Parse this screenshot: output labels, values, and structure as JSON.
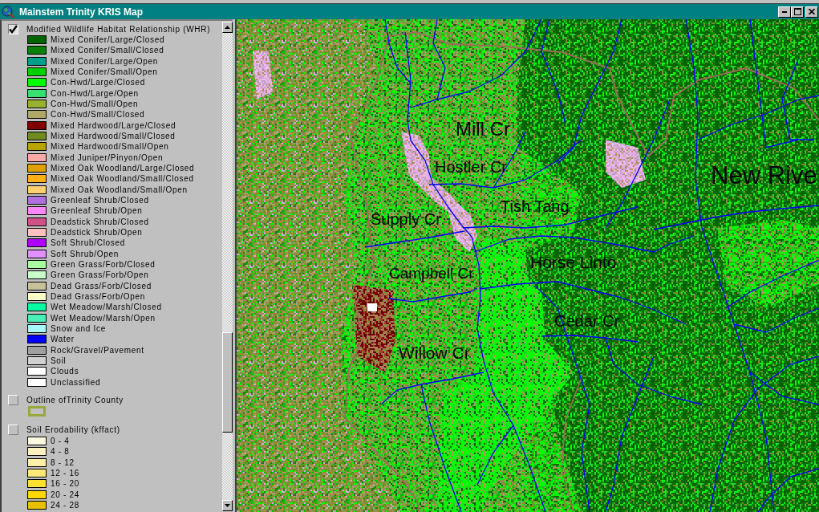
{
  "window": {
    "title": "Mainstem Trinity KRIS Map"
  },
  "legend": {
    "layers": [
      {
        "name": "Modified Wildlife Habitat Relationship (WHR)",
        "checked": true,
        "classes": [
          {
            "kind": "fill",
            "label": "Mixed Conifer/Large/Closed",
            "color": "#006400"
          },
          {
            "kind": "fill",
            "label": "Mixed Conifer/Small/Closed",
            "color": "#0a800a"
          },
          {
            "kind": "fill",
            "label": "Mixed Conifer/Large/Open",
            "color": "#00a08c"
          },
          {
            "kind": "fill",
            "label": "Mixed Conifer/Small/Open",
            "color": "#00d000"
          },
          {
            "kind": "fill",
            "label": "Con-Hwd/Large/Closed",
            "color": "#00ff00"
          },
          {
            "kind": "fill",
            "label": "Con-Hwd/Large/Open",
            "color": "#38e070"
          },
          {
            "kind": "fill",
            "label": "Con-Hwd/Small/Open",
            "color": "#99b131"
          },
          {
            "kind": "fill",
            "label": "Con-Hwd/Small/Closed",
            "color": "#b0a868"
          },
          {
            "kind": "fill",
            "label": "Mixed Hardwood/Large/Closed",
            "color": "#800000"
          },
          {
            "kind": "fill",
            "label": "Mixed Hardwood/Small/Closed",
            "color": "#6f8a20"
          },
          {
            "kind": "fill",
            "label": "Mixed Hardwood/Small/Open",
            "color": "#b8a400"
          },
          {
            "kind": "fill",
            "label": "Mixed Juniper/Pinyon/Open",
            "color": "#ffa8a8"
          },
          {
            "kind": "fill",
            "label": "Mixed Oak Woodland/Large/Closed",
            "color": "#e0a000"
          },
          {
            "kind": "fill",
            "label": "Mixed Oak Woodland/Small/Closed",
            "color": "#ffb018"
          },
          {
            "kind": "fill",
            "label": "Mixed Oak Woodland/Small/Open",
            "color": "#ffd070"
          },
          {
            "kind": "fill",
            "label": "Greenleaf Shrub/Closed",
            "color": "#b070e0"
          },
          {
            "kind": "fill",
            "label": "Greenleaf Shrub/Open",
            "color": "#ff88f8"
          },
          {
            "kind": "fill",
            "label": "Deadstick Shrub/Closed",
            "color": "#d05088"
          },
          {
            "kind": "fill",
            "label": "Deadstick Shrub/Open",
            "color": "#ffc0c0"
          },
          {
            "kind": "fill",
            "label": "Soft Shrub/Closed",
            "color": "#b000ff"
          },
          {
            "kind": "fill",
            "label": "Soft Shrub/Open",
            "color": "#e090ff"
          },
          {
            "kind": "fill",
            "label": "Green Grass/Forb/Closed",
            "color": "#a8ffa0"
          },
          {
            "kind": "fill",
            "label": "Green Grass/Forb/Open",
            "color": "#c8ffc8"
          },
          {
            "kind": "fill",
            "label": "Dead Grass/Forb/Closed",
            "color": "#c8c098"
          },
          {
            "kind": "fill",
            "label": "Dead Grass/Forb/Open",
            "color": "#ffffc8"
          },
          {
            "kind": "fill",
            "label": "Wet Meadow/Marsh/Closed",
            "color": "#00ffa0"
          },
          {
            "kind": "fill",
            "label": "Wet Meadow/Marsh/Open",
            "color": "#48f0b8"
          },
          {
            "kind": "fill",
            "label": "Snow and Ice",
            "color": "#a8f8ff"
          },
          {
            "kind": "fill",
            "label": "Water",
            "color": "#0000ff"
          },
          {
            "kind": "fill",
            "label": "Rock/Gravel/Pavement",
            "color": "#a0a0a0"
          },
          {
            "kind": "fill",
            "label": "Soil",
            "color": "#d0d0d0"
          },
          {
            "kind": "fill",
            "label": "Clouds",
            "color": "#ffffff"
          },
          {
            "kind": "fill",
            "label": "Unclassified",
            "color": "#ffffff"
          }
        ]
      },
      {
        "name": "Outline ofTrinity County",
        "checked": false,
        "classes": [
          {
            "kind": "outline",
            "color": "#9aa83a"
          }
        ]
      },
      {
        "name": "Soil Erodability (kffact)",
        "checked": false,
        "classes": [
          {
            "kind": "fill",
            "label": "0 - 4",
            "color": "#fff8e0"
          },
          {
            "kind": "fill",
            "label": "4 - 8",
            "color": "#fff0c0"
          },
          {
            "kind": "fill",
            "label": "8 - 12",
            "color": "#fff0a8"
          },
          {
            "kind": "fill",
            "label": "12 - 16",
            "color": "#ffe878"
          },
          {
            "kind": "fill",
            "label": "16 - 20",
            "color": "#ffe030"
          },
          {
            "kind": "fill",
            "label": "20 - 24",
            "color": "#ffd800"
          },
          {
            "kind": "fill",
            "label": "24 - 28",
            "color": "#e8c000"
          }
        ]
      }
    ]
  },
  "map": {
    "labels": [
      "Mill Cr",
      "Hostler Cr",
      "New Rive",
      "Tish Tang",
      "Supply Cr",
      "Horse Linto",
      "Campbell Cr",
      "Cedar Cr",
      "Willow Cr"
    ]
  }
}
